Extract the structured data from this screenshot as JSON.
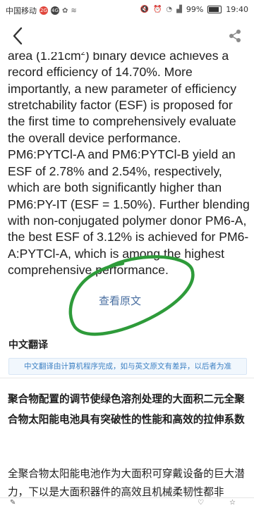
{
  "status_bar": {
    "carrier": "中国移动",
    "notif_badges": [
      "2G",
      "4G"
    ],
    "notif_icons": [
      "weibo-icon",
      "signal-hd-icon"
    ],
    "right_icons": [
      "mute-icon",
      "alarm-icon",
      "wifi-icon",
      "signal-icon"
    ],
    "battery": "99%",
    "time": "19:40"
  },
  "toolbar": {
    "back_icon": "chevron-left-icon",
    "share_icon": "share-icon"
  },
  "abstract": {
    "text_before_sup": "area (1.21cm",
    "sup": "2",
    "text_after_sup": ") binary device achieves a record efficiency of 14.70%. More importantly, a new parameter of efficiency stretchability factor (ESF) is proposed for the first time to comprehensively evaluate the overall device performance. PM6:PYTCl-A and PM6:PYTCl-B yield an ESF of 2.78% and 2.54%, respectively, which are both significantly higher than PM6:PY-IT (ESF = 1.50%). Further blending with non-conjugated polymer donor PM6-A, the best ESF of 3.12% is achieved for PM6-A:PYTCl-A, which is among the highest comprehensive performance."
  },
  "view_original_label": "查看原文",
  "annotation_color": "#2e9b3a",
  "translation": {
    "section_title": "中文翻译",
    "disclaimer": "中文翻译由计算机程序完成，如与英文原文有差异，以后者为准",
    "title": "聚合物配置的调节使绿色溶剂处理的大面积二元全聚合物太阳能电池具有突破性的性能和高效的拉伸系数",
    "body": "全聚合物太阳能电池作为大面积可穿戴设备的巨大潜力，下以是大面积器件的高效且机械柔韧性都非"
  },
  "accent_link_color": "#4a6fa1",
  "disclaimer_color": "#3f82c4"
}
